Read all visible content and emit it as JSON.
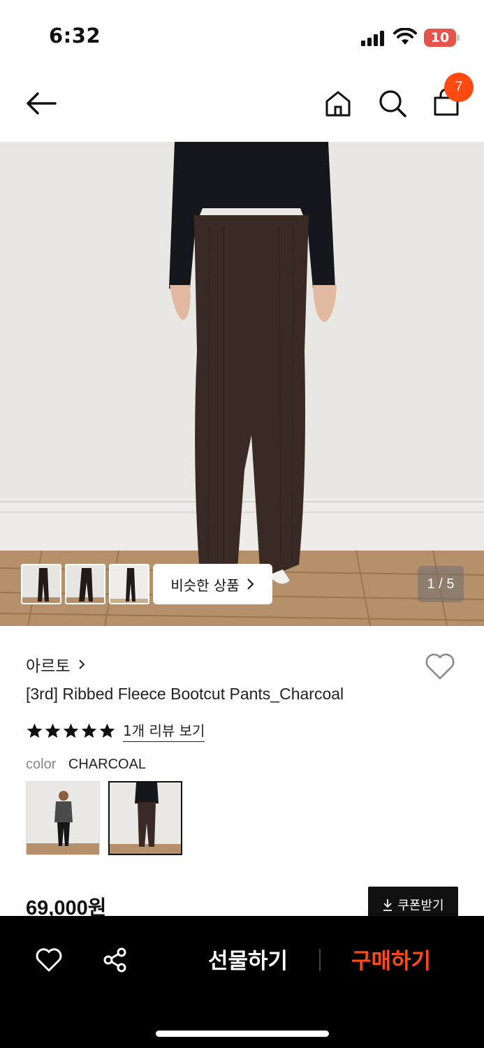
{
  "status_bar": {
    "time": "6:32",
    "battery": "10"
  },
  "nav": {
    "cart_count": "7"
  },
  "hero": {
    "similar_products_label": "비슷한 상품",
    "page_indicator": "1 / 5"
  },
  "product": {
    "brand": "아르토",
    "name": "[3rd] Ribbed Fleece Bootcut Pants_Charcoal",
    "rating": 5,
    "review_link": "1개 리뷰 보기",
    "color_label": "color",
    "color_value": "CHARCOAL",
    "price": "69,000원",
    "coupon_label": "쿠폰받기"
  },
  "bottom_bar": {
    "gift_label": "선물하기",
    "buy_label": "구매하기"
  },
  "colors": {
    "accent": "#ff4b12",
    "bottom_bar_bg": "#000000"
  },
  "icons": [
    "back-arrow-icon",
    "home-icon",
    "search-icon",
    "shopping-bag-icon",
    "heart-icon",
    "share-icon",
    "download-icon",
    "chevron-right-icon"
  ]
}
